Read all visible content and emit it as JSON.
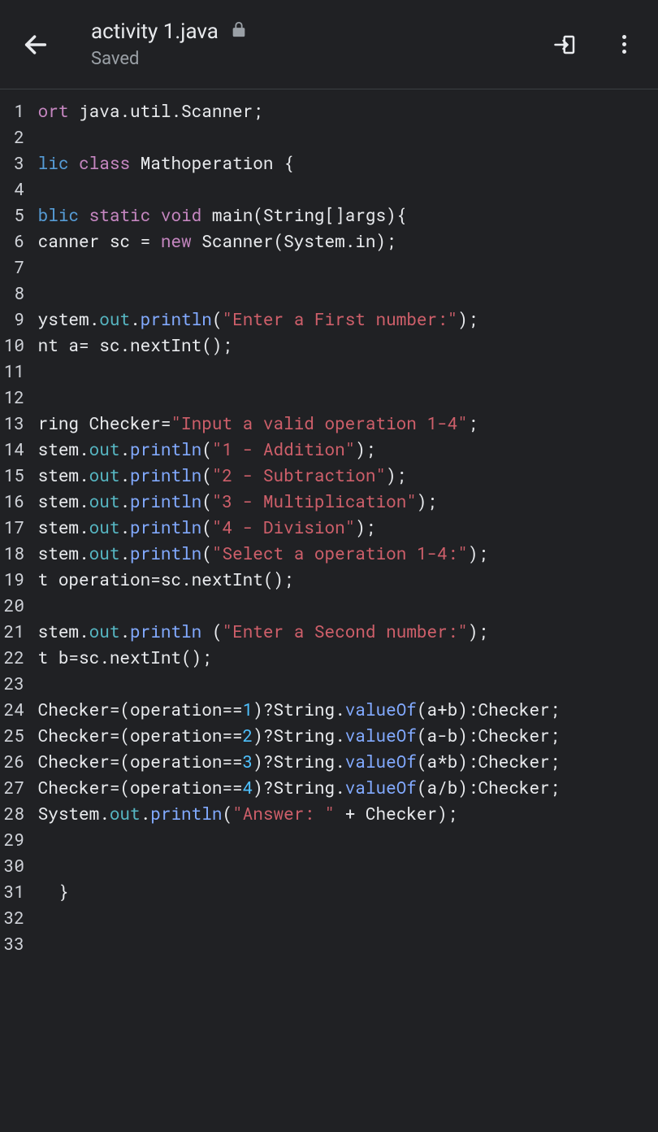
{
  "header": {
    "filename": "activity 1.java",
    "saved": "Saved"
  },
  "code": {
    "totalLines": 33,
    "lines": [
      [
        {
          "c": "kw-a",
          "t": "ort"
        },
        {
          "c": "pln",
          "t": " java.util.Scanner;"
        }
      ],
      [],
      [
        {
          "c": "kw-b",
          "t": "lic"
        },
        {
          "c": "pln",
          "t": " "
        },
        {
          "c": "kw-a",
          "t": "class"
        },
        {
          "c": "pln",
          "t": " Mathoperation {"
        }
      ],
      [],
      [
        {
          "c": "kw-b",
          "t": "blic"
        },
        {
          "c": "pln",
          "t": " "
        },
        {
          "c": "kw-a",
          "t": "static"
        },
        {
          "c": "pln",
          "t": " "
        },
        {
          "c": "kw-a",
          "t": "void"
        },
        {
          "c": "pln",
          "t": " main(String[]args){"
        }
      ],
      [
        {
          "c": "pln",
          "t": "canner sc = "
        },
        {
          "c": "kw-a",
          "t": "new"
        },
        {
          "c": "pln",
          "t": " Scanner(System.in);"
        }
      ],
      [],
      [],
      [
        {
          "c": "pln",
          "t": "ystem."
        },
        {
          "c": "mem",
          "t": "out"
        },
        {
          "c": "pln",
          "t": "."
        },
        {
          "c": "mth",
          "t": "println"
        },
        {
          "c": "pln",
          "t": "("
        },
        {
          "c": "str",
          "t": "\"Enter a First number:\""
        },
        {
          "c": "pln",
          "t": ");"
        }
      ],
      [
        {
          "c": "pln",
          "t": "nt a= sc.nextInt();"
        }
      ],
      [],
      [],
      [
        {
          "c": "pln",
          "t": "ring Checker="
        },
        {
          "c": "str",
          "t": "\"Input a valid operation 1-4\""
        },
        {
          "c": "pln",
          "t": ";"
        }
      ],
      [
        {
          "c": "pln",
          "t": "stem."
        },
        {
          "c": "mem",
          "t": "out"
        },
        {
          "c": "pln",
          "t": "."
        },
        {
          "c": "mth",
          "t": "println"
        },
        {
          "c": "pln",
          "t": "("
        },
        {
          "c": "str",
          "t": "\"1 - Addition\""
        },
        {
          "c": "pln",
          "t": ");"
        }
      ],
      [
        {
          "c": "pln",
          "t": "stem."
        },
        {
          "c": "mem",
          "t": "out"
        },
        {
          "c": "pln",
          "t": "."
        },
        {
          "c": "mth",
          "t": "println"
        },
        {
          "c": "pln",
          "t": "("
        },
        {
          "c": "str",
          "t": "\"2 - Subtraction\""
        },
        {
          "c": "pln",
          "t": ");"
        }
      ],
      [
        {
          "c": "pln",
          "t": "stem."
        },
        {
          "c": "mem",
          "t": "out"
        },
        {
          "c": "pln",
          "t": "."
        },
        {
          "c": "mth",
          "t": "println"
        },
        {
          "c": "pln",
          "t": "("
        },
        {
          "c": "str",
          "t": "\"3 - Multiplication\""
        },
        {
          "c": "pln",
          "t": ");"
        }
      ],
      [
        {
          "c": "pln",
          "t": "stem."
        },
        {
          "c": "mem",
          "t": "out"
        },
        {
          "c": "pln",
          "t": "."
        },
        {
          "c": "mth",
          "t": "println"
        },
        {
          "c": "pln",
          "t": "("
        },
        {
          "c": "str",
          "t": "\"4 - Division\""
        },
        {
          "c": "pln",
          "t": ");"
        }
      ],
      [
        {
          "c": "pln",
          "t": "stem."
        },
        {
          "c": "mem",
          "t": "out"
        },
        {
          "c": "pln",
          "t": "."
        },
        {
          "c": "mth",
          "t": "println"
        },
        {
          "c": "pln",
          "t": "("
        },
        {
          "c": "str",
          "t": "\"Select a operation 1-4:\""
        },
        {
          "c": "pln",
          "t": ");"
        }
      ],
      [
        {
          "c": "pln",
          "t": "t operation=sc.nextInt();"
        }
      ],
      [],
      [
        {
          "c": "pln",
          "t": "stem."
        },
        {
          "c": "mem",
          "t": "out"
        },
        {
          "c": "pln",
          "t": "."
        },
        {
          "c": "mth",
          "t": "println"
        },
        {
          "c": "pln",
          "t": " ("
        },
        {
          "c": "str",
          "t": "\"Enter a Second number:\""
        },
        {
          "c": "pln",
          "t": ");"
        }
      ],
      [
        {
          "c": "pln",
          "t": "t b=sc.nextInt();"
        }
      ],
      [],
      [
        {
          "c": "pln",
          "t": "Checker=(operation=="
        },
        {
          "c": "num",
          "t": "1"
        },
        {
          "c": "pln",
          "t": ")?String."
        },
        {
          "c": "mth",
          "t": "valueOf"
        },
        {
          "c": "pln",
          "t": "(a+b):Checker;"
        }
      ],
      [
        {
          "c": "pln",
          "t": "Checker=(operation=="
        },
        {
          "c": "num",
          "t": "2"
        },
        {
          "c": "pln",
          "t": ")?String."
        },
        {
          "c": "mth",
          "t": "valueOf"
        },
        {
          "c": "pln",
          "t": "(a-b):Checker;"
        }
      ],
      [
        {
          "c": "pln",
          "t": "Checker=(operation=="
        },
        {
          "c": "num",
          "t": "3"
        },
        {
          "c": "pln",
          "t": ")?String."
        },
        {
          "c": "mth",
          "t": "valueOf"
        },
        {
          "c": "pln",
          "t": "(a*b):Checker;"
        }
      ],
      [
        {
          "c": "pln",
          "t": "Checker=(operation=="
        },
        {
          "c": "num",
          "t": "4"
        },
        {
          "c": "pln",
          "t": ")?String."
        },
        {
          "c": "mth",
          "t": "valueOf"
        },
        {
          "c": "pln",
          "t": "(a/b):Checker;"
        }
      ],
      [
        {
          "c": "pln",
          "t": "System."
        },
        {
          "c": "mem",
          "t": "out"
        },
        {
          "c": "pln",
          "t": "."
        },
        {
          "c": "mth",
          "t": "println"
        },
        {
          "c": "pln",
          "t": "("
        },
        {
          "c": "str",
          "t": "\"Answer: \""
        },
        {
          "c": "pln",
          "t": " + Checker);"
        }
      ],
      [],
      [],
      [
        {
          "c": "pln",
          "t": "  }"
        }
      ],
      [],
      []
    ]
  }
}
